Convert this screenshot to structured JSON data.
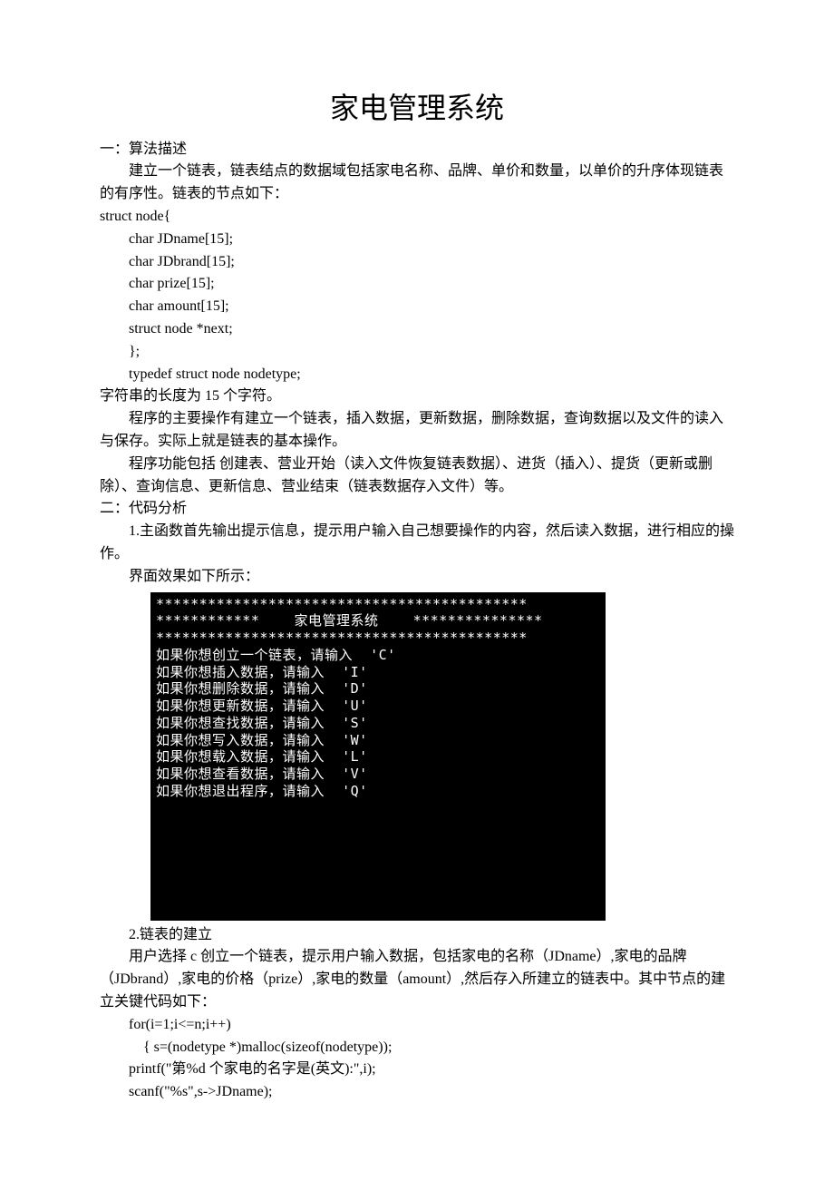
{
  "title": "家电管理系统",
  "s1_heading": "一：算法描述",
  "s1_p1": "建立一个链表，链表结点的数据域包括家电名称、品牌、单价和数量，以单价的升序体现链表的有序性。链表的节点如下：",
  "code1_l1": "struct node{",
  "code1_l2": "char JDname[15];",
  "code1_l3": "char JDbrand[15];",
  "code1_l4": "char prize[15];",
  "code1_l5": "char amount[15];",
  "code1_l6": "struct node *next;",
  "code1_l7": "};",
  "code1_l8": "typedef struct node nodetype;",
  "s1_p2": "字符串的长度为 15 个字符。",
  "s1_p3": "程序的主要操作有建立一个链表，插入数据，更新数据，删除数据，查询数据以及文件的读入与保存。实际上就是链表的基本操作。",
  "s1_p4": "程序功能包括 创建表、营业开始（读入文件恢复链表数据）、进货（插入）、提货（更新或删除）、查询信息、更新信息、营业结束（链表数据存入文件）等。",
  "s2_heading": "二：代码分析",
  "s2_p1": "1.主函数首先输出提示信息，提示用户输入自己想要操作的内容，然后读入数据，进行相应的操作。",
  "s2_p2": "界面效果如下所示：",
  "terminal_l1": "*******************************************",
  "terminal_l2": "************    家电管理系统    ***************",
  "terminal_l3": "*******************************************",
  "terminal_l4": "如果你想创立一个链表，请输入  'C'",
  "terminal_l5": "如果你想插入数据，请输入  'I'",
  "terminal_l6": "如果你想删除数据，请输入  'D'",
  "terminal_l7": "如果你想更新数据，请输入  'U'",
  "terminal_l8": "如果你想查找数据，请输入  'S'",
  "terminal_l9": "如果你想写入数据，请输入  'W'",
  "terminal_l10": "如果你想载入数据，请输入  'L'",
  "terminal_l11": "如果你想查看数据，请输入  'V'",
  "terminal_l12": "如果你想退出程序，请输入  'Q'",
  "s3_heading": "2.链表的建立",
  "s3_p1": "用户选择 c 创立一个链表，提示用户输入数据，包括家电的名称（JDname）,家电的品牌（JDbrand）,家电的价格（prize）,家电的数量（amount）,然后存入所建立的链表中。其中节点的建立关键代码如下：",
  "code2_l1": "for(i=1;i<=n;i++)",
  "code2_l2": "{ s=(nodetype *)malloc(sizeof(nodetype));",
  "code2_l3": "printf(\"第%d 个家电的名字是(英文):\",i);",
  "code2_l4": "scanf(\"%s\",s->JDname);"
}
